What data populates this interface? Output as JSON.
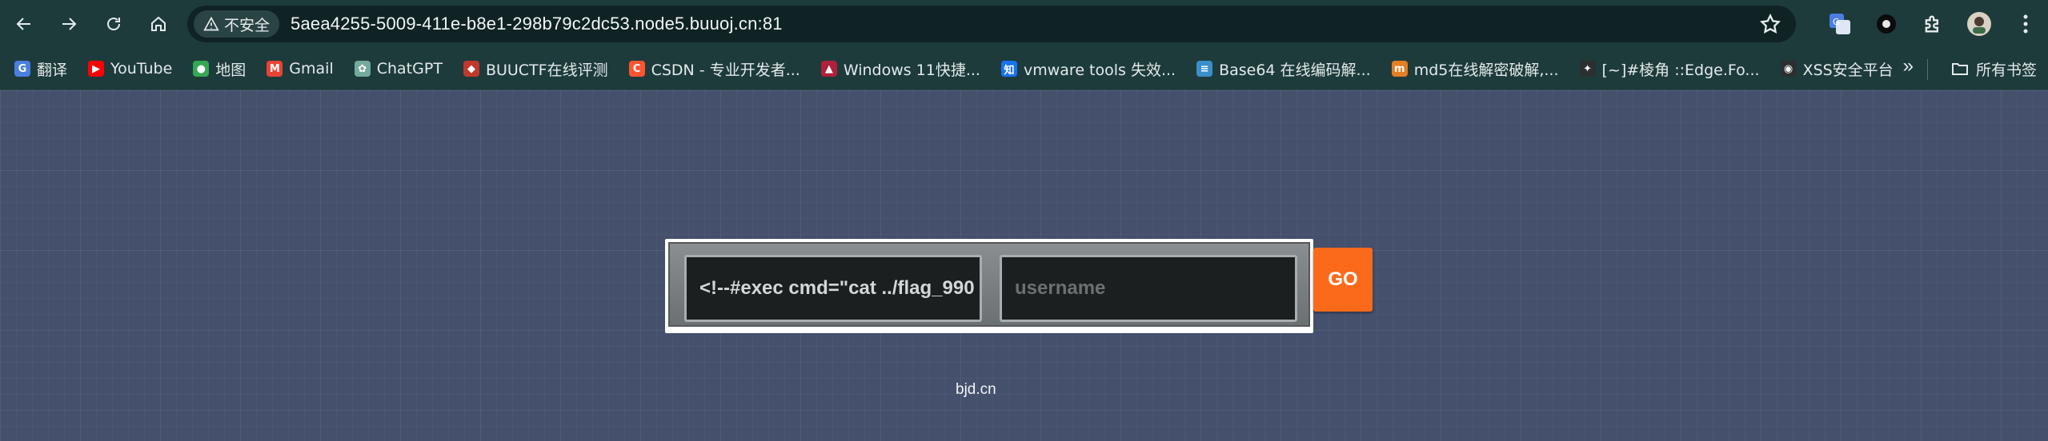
{
  "browser": {
    "security_label": "不安全",
    "url": "5aea4255-5009-411e-b8e1-298b79c2dc53.node5.buuoj.cn:81",
    "icons": [
      "back-icon",
      "forward-icon",
      "reload-icon",
      "home-icon",
      "warning-icon",
      "star-icon",
      "translate-icon",
      "extension-circle-icon",
      "puzzle-icon",
      "avatar",
      "more-icon"
    ]
  },
  "bookmarks": {
    "items": [
      {
        "label": "翻译",
        "icon": "translate-icon",
        "color": "#4a7fe0"
      },
      {
        "label": "YouTube",
        "icon": "youtube-icon",
        "color": "#ff0000"
      },
      {
        "label": "地图",
        "icon": "maps-pin-icon",
        "color": "#34a853"
      },
      {
        "label": "Gmail",
        "icon": "gmail-icon",
        "color": "#ea4335"
      },
      {
        "label": "ChatGPT",
        "icon": "chatgpt-icon",
        "color": "#74aa9c"
      },
      {
        "label": "BUUCTF在线评测",
        "icon": "buuctf-icon",
        "color": "#c0392b"
      },
      {
        "label": "CSDN - 专业开发者...",
        "icon": "csdn-icon",
        "color": "#fc5531"
      },
      {
        "label": "Windows 11快捷...",
        "icon": "windows-icon",
        "color": "#b0203a"
      },
      {
        "label": "vmware tools 失效...",
        "icon": "zhihu-icon",
        "color": "#1772f6"
      },
      {
        "label": "Base64 在线编码解...",
        "icon": "base64-icon",
        "color": "#3a8fc9"
      },
      {
        "label": "md5在线解密破解,...",
        "icon": "md5-icon",
        "color": "#e67e22"
      },
      {
        "label": "[~]#棱角 ::Edge.Fo...",
        "icon": "edge-forum-icon",
        "color": "#2b2f30"
      },
      {
        "label": "XSS安全平台",
        "icon": "xss-icon",
        "color": "#2b2f30"
      }
    ],
    "more": "»",
    "all_label": "所有书签"
  },
  "page": {
    "field1_value": "<!--#exec cmd=\"cat ../flag_990",
    "field2_placeholder": "username",
    "go_label": "GO",
    "footer": "bjd.cn"
  },
  "colors": {
    "page_bg": "#44506c",
    "toolbar_bg": "#1e3b3c",
    "go_button": "#fb6a1b"
  }
}
